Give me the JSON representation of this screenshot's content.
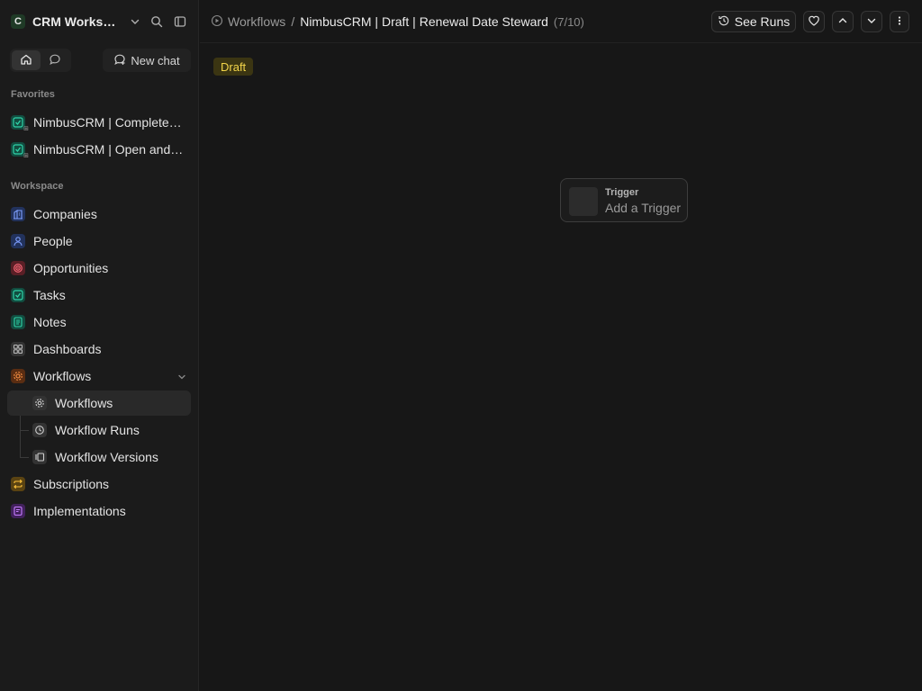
{
  "workspace": {
    "initial": "C",
    "name": "CRM Workspace"
  },
  "home_toggle": {},
  "new_chat_label": "New chat",
  "favorites": {
    "title": "Favorites",
    "items": [
      {
        "label": "NimbusCRM | Completed Tasks"
      },
      {
        "label": "NimbusCRM | Open and Overdue Tasks"
      }
    ]
  },
  "workspace_section": {
    "title": "Workspace",
    "items": [
      {
        "label": "Companies",
        "color": "#4a6fd8"
      },
      {
        "label": "People",
        "color": "#3d5fd1"
      },
      {
        "label": "Opportunities",
        "color": "#d84a4a"
      },
      {
        "label": "Tasks",
        "color": "#20a58a"
      },
      {
        "label": "Notes",
        "color": "#20a58a"
      },
      {
        "label": "Dashboards",
        "color": "#6b6b6b"
      },
      {
        "label": "Workflows",
        "color": "#e0762a"
      }
    ],
    "workflow_children": [
      {
        "label": "Workflows"
      },
      {
        "label": "Workflow Runs"
      },
      {
        "label": "Workflow Versions"
      }
    ],
    "more_items": [
      {
        "label": "Subscriptions",
        "color": "#d9a21c"
      },
      {
        "label": "Implementations",
        "color": "#9d4fd1"
      }
    ]
  },
  "breadcrumb": {
    "parent": "Workflows",
    "separator": "/",
    "current": "NimbusCRM | Draft | Renewal Date Steward",
    "position": "(7/10)"
  },
  "toolbar": {
    "see_runs_label": "See Runs"
  },
  "canvas": {
    "status_badge": "Draft",
    "trigger": {
      "title": "Trigger",
      "subtitle": "Add a Trigger"
    }
  }
}
